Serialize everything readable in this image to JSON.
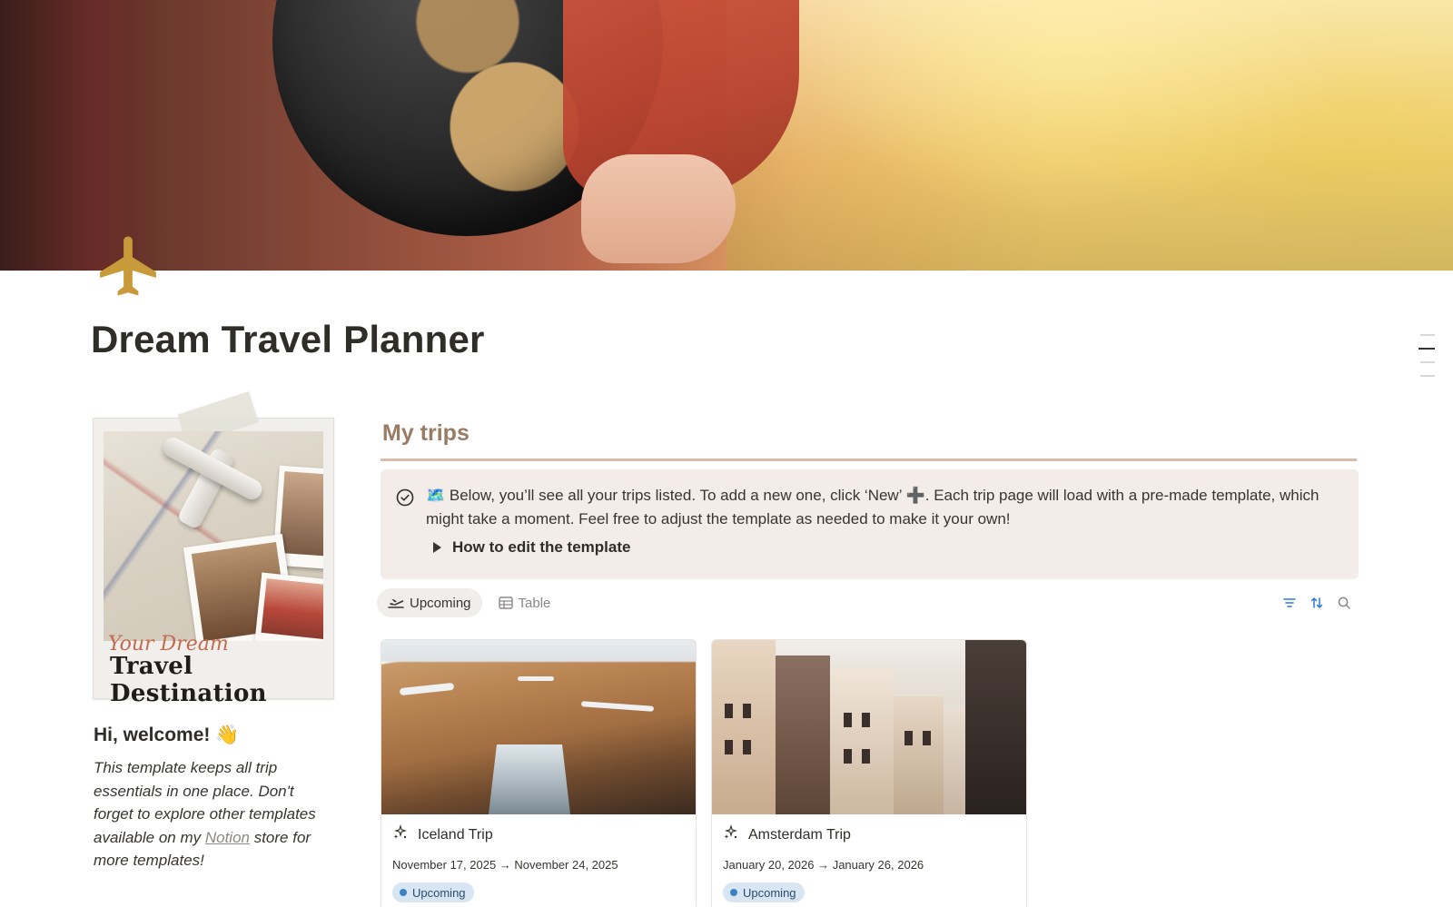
{
  "page": {
    "title": "Dream Travel Planner",
    "icon": "airplane-icon"
  },
  "sidebar_card": {
    "script_text": "Your Dream",
    "caption": "Travel Destination"
  },
  "welcome": {
    "heading": "Hi, welcome! 👋",
    "intro_before": "This template keeps all trip essentials in one place. Don't forget to explore other templates available on my ",
    "link_text": "Notion",
    "intro_after": " store for more templates!"
  },
  "trips": {
    "section_title": "My trips",
    "callout_text": "🗺️ Below, you’ll see all your trips listed. To add a new one, click ‘New’ ➕. Each trip page will load with a pre-made template, which might take a moment. Feel free to adjust the template as needed to make it your own!",
    "toggle_label": "How to edit the template",
    "views": [
      {
        "label": "Upcoming",
        "icon": "plane-departure-icon",
        "active": true
      },
      {
        "label": "Table",
        "icon": "table-icon",
        "active": false
      }
    ],
    "tools": [
      "filter-icon",
      "sort-icon",
      "search-icon"
    ],
    "cards": [
      {
        "name": "Iceland Trip",
        "dates": "November 17, 2025 → November 24, 2025",
        "status": "Upcoming"
      },
      {
        "name": "Amsterdam Trip",
        "dates": "January 20, 2026 → January 26, 2026",
        "status": "Upcoming"
      }
    ]
  },
  "colors": {
    "accent_brown": "#9a7b64",
    "callout_bg": "#f4ece8",
    "icon_gold": "#c99a3a",
    "status_blue": "#3b82c4"
  }
}
